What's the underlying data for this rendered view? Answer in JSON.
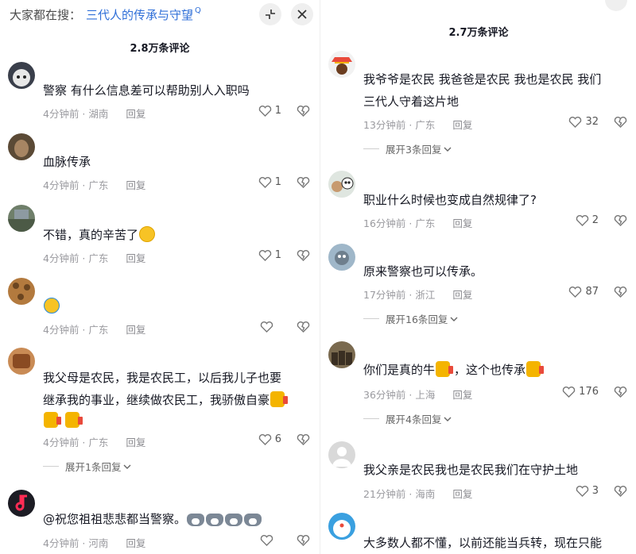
{
  "left_panel": {
    "search_prefix": "大家都在搜：",
    "search_query": "三代人的传承与守望",
    "comment_count": "2.8万条评论",
    "comments": [
      {
        "text": "警察 有什么信息差可以帮助别人入职吗",
        "time": "4分钟前",
        "location": "湖南",
        "reply": "回复",
        "likes": "1"
      },
      {
        "text": "血脉传承",
        "time": "4分钟前",
        "location": "广东",
        "reply": "回复",
        "likes": "1"
      },
      {
        "text": "不错，真的辛苦了",
        "time": "4分钟前",
        "location": "广东",
        "reply": "回复",
        "likes": "1",
        "emoji": "grin-sweat"
      },
      {
        "text": "",
        "time": "4分钟前",
        "location": "广东",
        "reply": "回复",
        "likes": "",
        "emoji": "rolling-laugh"
      },
      {
        "text_line1": "我父母是农民，我是农民工，以后我儿子也要",
        "text_line2": "继承我的事业，继续做农民工，我骄傲自豪",
        "time": "4分钟前",
        "location": "广东",
        "reply": "回复",
        "likes": "6",
        "expand": "展开1条回复",
        "emoji": "thumbs-up"
      },
      {
        "text": "@祝您祖祖悲悲都当警察。",
        "time": "4分钟前",
        "location": "河南",
        "reply": "回复",
        "likes": "",
        "emoji": "husky"
      }
    ]
  },
  "right_panel": {
    "comment_count": "2.7万条评论",
    "comments": [
      {
        "text_line1": "我爷爷是农民 我爸爸是农民 我也是农民 我们",
        "text_line2": "三代人守着这片地",
        "time": "13分钟前",
        "location": "广东",
        "reply": "回复",
        "likes": "32",
        "expand": "展开3条回复"
      },
      {
        "text": "职业什么时候也变成自然规律了?",
        "time": "16分钟前",
        "location": "广东",
        "reply": "回复",
        "likes": "2"
      },
      {
        "text": "原来警察也可以传承。",
        "time": "17分钟前",
        "location": "浙江",
        "reply": "回复",
        "likes": "87",
        "expand": "展开16条回复"
      },
      {
        "text_a": "你们是真的牛",
        "text_b": "，这个也传承",
        "time": "36分钟前",
        "location": "上海",
        "reply": "回复",
        "likes": "176",
        "expand": "展开4条回复",
        "emoji": "thumbs-up"
      },
      {
        "text": "我父亲是农民我也是农民我们在守护土地",
        "time": "21分钟前",
        "location": "海南",
        "reply": "回复",
        "likes": "3"
      },
      {
        "text": "大多数人都不懂，以前还能当兵转，现在只能",
        "time": "",
        "location": "",
        "reply": "",
        "likes": ""
      }
    ]
  },
  "colors": {
    "link": "#2f6fd8",
    "meta": "#9a9a9f",
    "text": "#161823",
    "divider": "#eeeeee"
  }
}
